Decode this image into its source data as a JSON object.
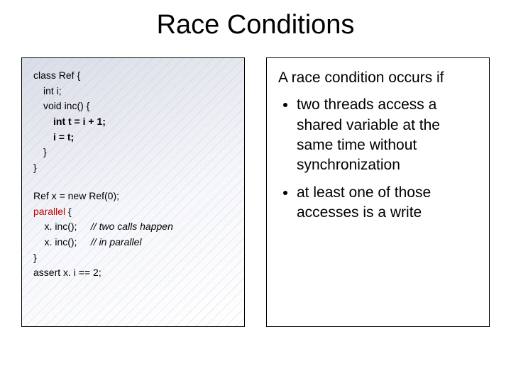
{
  "title": "Race Conditions",
  "code": {
    "l1": "class Ref {",
    "l2": "int i;",
    "l3": "void inc() {",
    "l4": "int t = i + 1;",
    "l5": "i = t;",
    "l6": "}",
    "l7": "}",
    "r1": "Ref x = new Ref(0);",
    "r2a": "parallel",
    "r2b": " {",
    "r3a": "    x. inc();     ",
    "r3b": "// two calls happen",
    "r4a": "    x. inc();     ",
    "r4b": "// in parallel",
    "r5": "}",
    "r6": "assert x. i == 2;"
  },
  "explain": {
    "lead": "A race condition occurs if",
    "b1": "two threads access a shared variable at the same time without synchronization",
    "b2": "at least one of those accesses is a write"
  }
}
